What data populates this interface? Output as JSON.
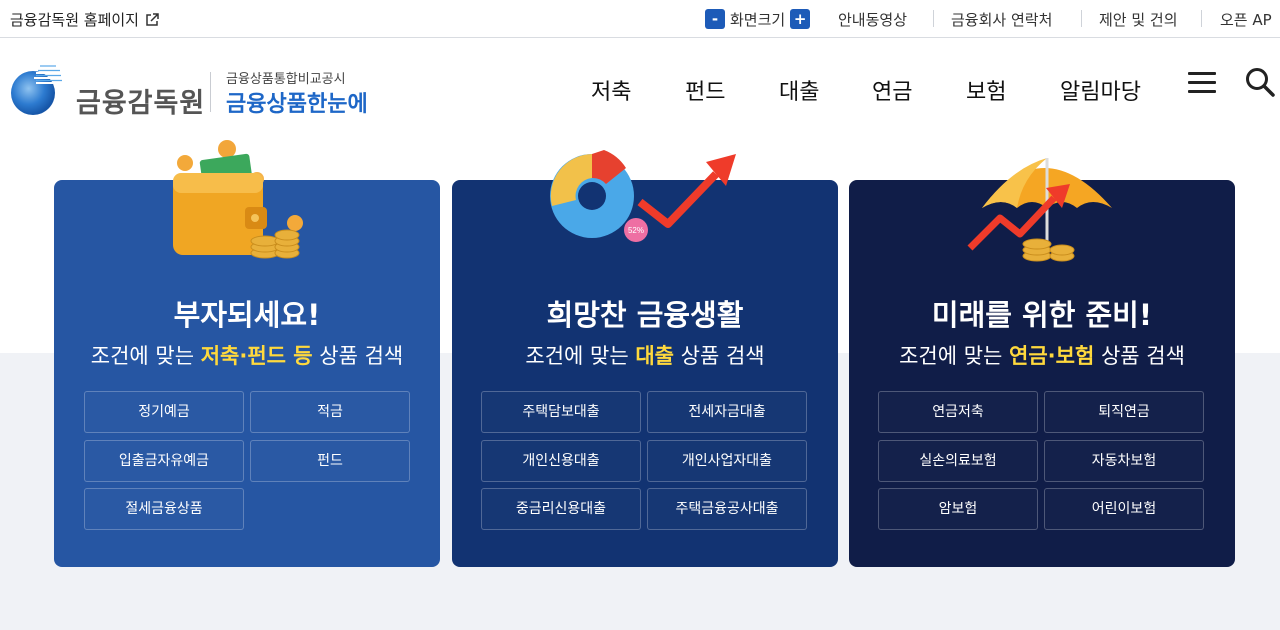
{
  "topbar": {
    "home_link": "금융감독원 홈페이지",
    "zoom_label": "화면크기",
    "zoom_minus": "-",
    "zoom_plus": "+",
    "links": [
      "안내동영상",
      "금융회사 연락처",
      "제안 및 건의",
      "오픈 AP"
    ]
  },
  "header": {
    "logo_name": "금융감독원",
    "logo_sub": "금융상품통합비교공시",
    "logo_main": "금융상품한눈에",
    "nav": [
      "저축",
      "펀드",
      "대출",
      "연금",
      "보험",
      "알림마당"
    ]
  },
  "cards": [
    {
      "title": "부자되세요!",
      "sub_prefix": "조건에 맞는 ",
      "sub_highlight": "저축·펀드 등",
      "sub_suffix": " 상품 검색",
      "buttons": [
        "정기예금",
        "적금",
        "입출금자유예금",
        "펀드",
        "절세금융상품"
      ]
    },
    {
      "title": "희망찬 금융생활",
      "sub_prefix": "조건에 맞는 ",
      "sub_highlight": "대출",
      "sub_suffix": " 상품 검색",
      "buttons": [
        "주택담보대출",
        "전세자금대출",
        "개인신용대출",
        "개인사업자대출",
        "중금리신용대출",
        "주택금융공사대출"
      ]
    },
    {
      "title": "미래를 위한 준비!",
      "sub_prefix": "조건에 맞는 ",
      "sub_highlight": "연금·보험",
      "sub_suffix": " 상품 검색",
      "buttons": [
        "연금저축",
        "퇴직연금",
        "실손의료보험",
        "자동차보험",
        "암보험",
        "어린이보험"
      ]
    }
  ],
  "illustration_labels": {
    "donut_percent": "52%"
  },
  "colors": {
    "brand_blue": "#1e67c7",
    "card1": "#2656a3",
    "card2": "#123372",
    "card3": "#101d48",
    "highlight": "#ffd93d"
  }
}
